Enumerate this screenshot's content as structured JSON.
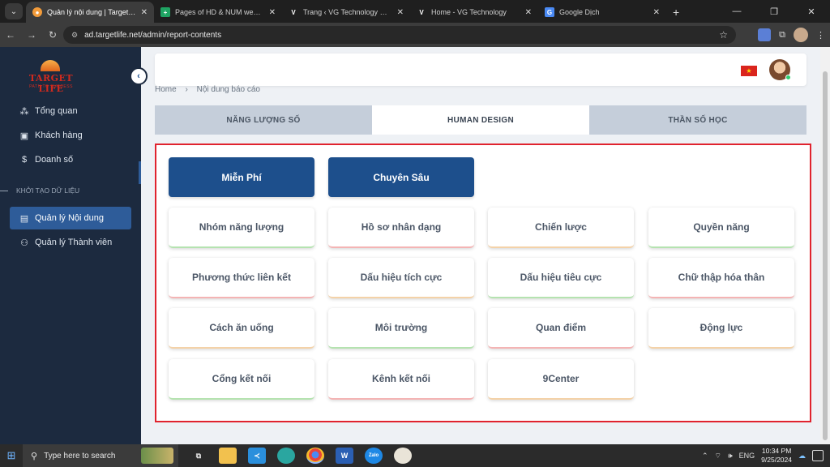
{
  "browser": {
    "tabs": [
      {
        "title": "Quản lý nội dung | Target Life",
        "active": true,
        "icon": "target-life-icon"
      },
      {
        "title": "Pages of HD & NUM web - Goo",
        "active": false,
        "icon": "sheets-icon"
      },
      {
        "title": "Trang ‹ VG Technology — Word",
        "active": false,
        "icon": "vg-icon"
      },
      {
        "title": "Home - VG Technology",
        "active": false,
        "icon": "vg-icon"
      },
      {
        "title": "Google Dịch",
        "active": false,
        "icon": "google-translate-icon"
      }
    ],
    "url": "ad.targetlife.net/admin/report-contents"
  },
  "sidebar": {
    "logo": {
      "name": "TARGET LIFE",
      "tagline": "PATH TO SUCCESS"
    },
    "items": [
      {
        "label": "Tổng quan",
        "icon": "chart-icon"
      },
      {
        "label": "Khách hàng",
        "icon": "customer-icon"
      },
      {
        "label": "Doanh số",
        "icon": "dollar-icon"
      }
    ],
    "section_label": "KHỞI TẠO DỮ LIỆU",
    "data_items": [
      {
        "label": "Quản lý Nội dung",
        "icon": "content-icon",
        "active": true
      },
      {
        "label": "Quản lý Thành viên",
        "icon": "members-icon",
        "active": false
      }
    ]
  },
  "header": {
    "flag": "Vietnam",
    "avatar": "user-avatar"
  },
  "breadcrumb": {
    "home": "Home",
    "current": "Nội dung báo cáo"
  },
  "page_tabs": [
    {
      "label": "NĂNG LƯỢNG SỐ",
      "active": false
    },
    {
      "label": "HUMAN DESIGN",
      "active": true
    },
    {
      "label": "THẦN SỐ HỌC",
      "active": false
    }
  ],
  "report_types": [
    {
      "label": "Miễn Phí"
    },
    {
      "label": "Chuyên Sâu"
    }
  ],
  "cards": [
    {
      "label": "Nhóm năng lượng"
    },
    {
      "label": "Hồ sơ nhân dạng"
    },
    {
      "label": "Chiến lược"
    },
    {
      "label": "Quyền năng"
    },
    {
      "label": "Phương thức liên kết"
    },
    {
      "label": "Dấu hiệu tích cực"
    },
    {
      "label": "Dấu hiệu tiêu cực"
    },
    {
      "label": "Chữ thập hóa thân"
    },
    {
      "label": "Cách ăn uống"
    },
    {
      "label": "Môi trường"
    },
    {
      "label": "Quan điểm"
    },
    {
      "label": "Động lực"
    },
    {
      "label": "Cổng kết nối"
    },
    {
      "label": "Kênh kết nối"
    },
    {
      "label": "9Center"
    }
  ],
  "taskbar": {
    "search_placeholder": "Type here to search",
    "language": "ENG",
    "time": "10:34 PM",
    "date": "9/25/2024"
  },
  "colors": {
    "sidebar": "#1c2a3f",
    "accent": "#1d4f8c",
    "highlight_border": "#e0232e"
  }
}
